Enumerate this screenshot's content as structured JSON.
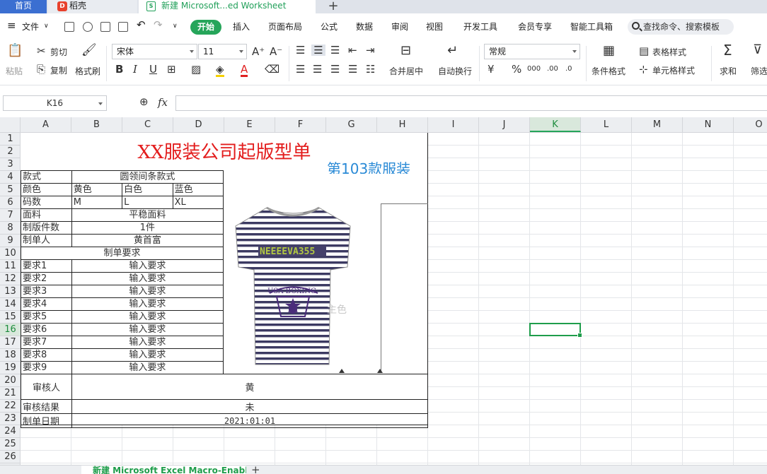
{
  "tabs": {
    "home": "首页",
    "docer": "稻壳",
    "doc": "新建 Microsoft...ed Worksheet"
  },
  "menu": {
    "file": "文件",
    "items": [
      "开始",
      "插入",
      "页面布局",
      "公式",
      "数据",
      "审阅",
      "视图",
      "开发工具",
      "会员专享",
      "智能工具箱"
    ],
    "search": "查找命令、搜索模板"
  },
  "toolbar": {
    "paste": "粘贴",
    "cut": "剪切",
    "copy": "复制",
    "format_painter": "格式刷",
    "font": "宋体",
    "size": "11",
    "bold": "B",
    "italic": "I",
    "underline": "U",
    "merge": "合并居中",
    "wrap": "自动换行",
    "number_format": "常规",
    "cond_format": "条件格式",
    "table_style": "表格样式",
    "cell_style": "单元格样式",
    "sum": "求和",
    "filter": "筛选",
    "currency": "¥",
    "percent": "%",
    "thousands": "000"
  },
  "formula": {
    "name_box": "K16",
    "fx": "fx"
  },
  "grid": {
    "columns": [
      "A",
      "B",
      "C",
      "D",
      "E",
      "F",
      "G",
      "H",
      "I",
      "J",
      "K",
      "L",
      "M",
      "N",
      "O"
    ],
    "selected_column": "K",
    "selected_row": "16",
    "rows": [
      "1",
      "2",
      "3",
      "4",
      "5",
      "6",
      "7",
      "8",
      "9",
      "10",
      "11",
      "12",
      "13",
      "14",
      "15",
      "16",
      "17",
      "18",
      "19",
      "20",
      "21",
      "22",
      "23",
      "24",
      "25",
      "26"
    ]
  },
  "sheet": {
    "title": "XX服装公司起版型单",
    "rows": [
      [
        "款式",
        "圆领间条款式"
      ],
      [
        "颜色",
        "黄色",
        "白色",
        "蓝色"
      ],
      [
        "码数",
        "M",
        "L",
        "XL"
      ],
      [
        "面料",
        "平稳面料"
      ],
      [
        "制版件数",
        "1件"
      ],
      [
        "制单人",
        "黄首富"
      ],
      [
        "制单要求"
      ],
      [
        "要求1",
        "输入要求"
      ],
      [
        "要求2",
        "输入要求"
      ],
      [
        "要求3",
        "输入要求"
      ],
      [
        "要求4",
        "输入要求"
      ],
      [
        "要求5",
        "输入要求"
      ],
      [
        "要求6",
        "输入要求"
      ],
      [
        "要求7",
        "输入要求"
      ],
      [
        "要求8",
        "输入要求"
      ],
      [
        "要求9",
        "输入要求"
      ]
    ],
    "reviewer_label": "审核人",
    "reviewer": "黄",
    "result_label": "审核结果",
    "result": "未",
    "date_label": "制单日期",
    "date": "2021:01:01",
    "overlay": "第103款服装",
    "watermark": "主色",
    "shirt_print_top": "NEEEEVA355",
    "shirt_print_logo": "USA BOXING"
  },
  "sheet_tab": "新建 Microsoft Excel Macro-Enable"
}
